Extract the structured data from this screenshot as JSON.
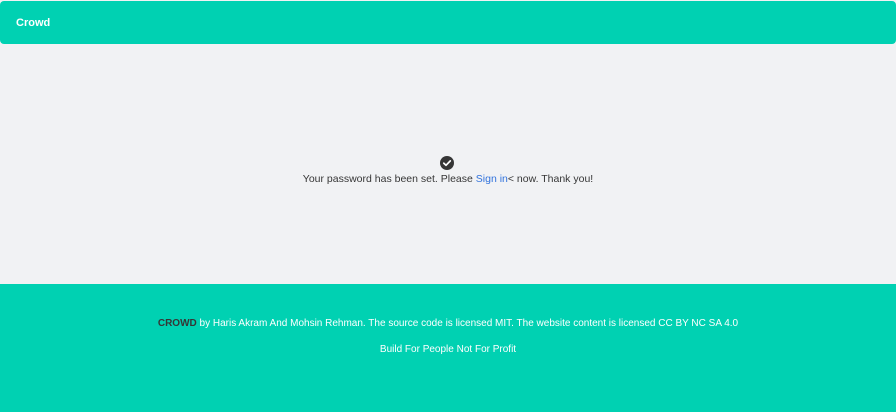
{
  "navbar": {
    "brand": "Crowd"
  },
  "main": {
    "icon": "check-circle-icon",
    "message_before": "Your password has been set. Please ",
    "sign_in_link": "Sign in",
    "message_after": "< now. Thank you!"
  },
  "footer": {
    "brand": "CROWD",
    "credits": " by Haris Akram And Mohsin Rehman. The source code is licensed MIT. The website content is licensed CC BY NC SA 4.0",
    "tagline": "Build For People Not For Profit"
  },
  "colors": {
    "accent": "#00d1b2",
    "background": "#f1f2f4",
    "link": "#3273dc",
    "text": "#363636"
  }
}
